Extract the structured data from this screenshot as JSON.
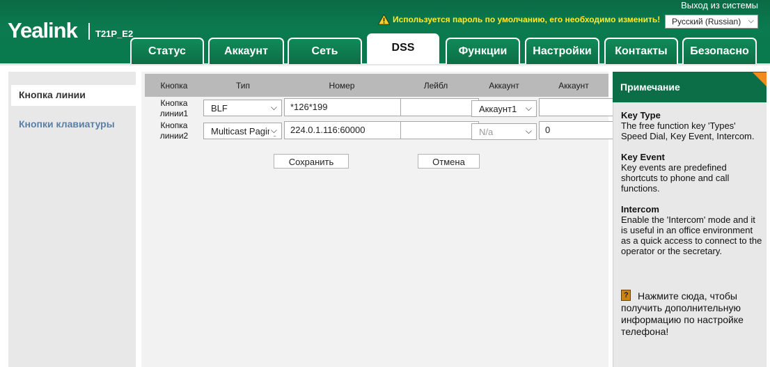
{
  "header": {
    "logo": "Yealink",
    "model": "T21P_E2",
    "logout": "Выход из системы",
    "warning": "Используется пароль по умолчанию, его необходимо изменить!",
    "language": "Русский (Russian)",
    "warning_color": "#ffeb2a",
    "brand_color": "#0b7a4f"
  },
  "tabs": [
    {
      "label": "Статус"
    },
    {
      "label": "Аккаунт"
    },
    {
      "label": "Сеть"
    },
    {
      "label": "DSS",
      "active": true
    },
    {
      "label": "Функции"
    },
    {
      "label": "Настройки"
    },
    {
      "label": "Контакты"
    },
    {
      "label": "Безопасно"
    }
  ],
  "sidebar": {
    "items": [
      {
        "label": "Кнопка линии",
        "active": true
      },
      {
        "label": "Кнопки клавиатуры"
      }
    ]
  },
  "table": {
    "headers": [
      "Кнопка",
      "Тип",
      "Номер",
      "Лейбл",
      "Аккаунт",
      "Аккаунт"
    ],
    "rows": [
      {
        "label": "Кнопка линии1",
        "type": "BLF",
        "number": "*126*199",
        "lbl": "",
        "account": "Аккаунт1",
        "extra": ""
      },
      {
        "label": "Кнопка линии2",
        "type": "Multicast Paging",
        "number": "224.0.1.116:60000",
        "lbl": "",
        "account": "N/a",
        "extra": "0"
      }
    ]
  },
  "buttons": {
    "save": "Сохранить",
    "cancel": "Отмена"
  },
  "note": {
    "title": "Примечание",
    "blocks": [
      {
        "title": "Key Type",
        "text": "The free function key 'Types' Speed Dial, Key Event, Intercom."
      },
      {
        "title": "Key Event",
        "text": "Key events are predefined shortcuts to phone and call functions."
      },
      {
        "title": "Intercom",
        "text": "Enable the 'Intercom' mode and it is useful in an office environment as a quick access to connect to the operator or the secretary."
      }
    ],
    "more": "Нажмите сюда, чтобы получить дополнительную информацию по настройке телефона!",
    "corner_color": "#f28a1e"
  },
  "icons": {
    "warning": "warning-triangle-icon",
    "dropdown": "chevron-down-icon",
    "help": "help-book-icon"
  }
}
